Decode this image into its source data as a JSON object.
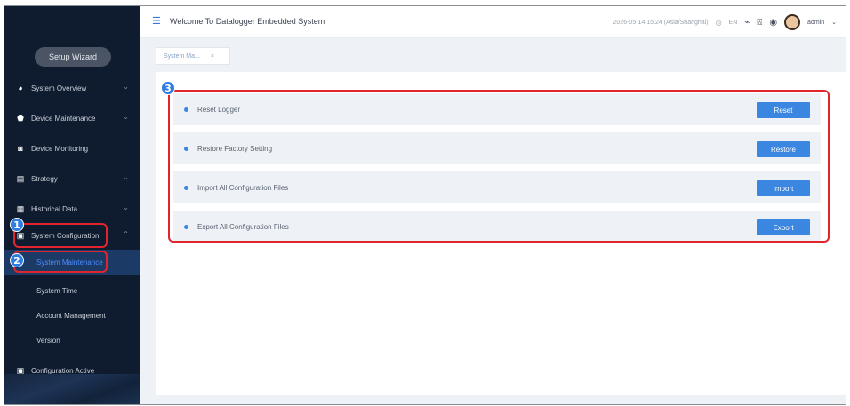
{
  "sidebar": {
    "wizard_label": "Setup Wizard",
    "items": [
      {
        "label": "System Overview",
        "icon": "gauge-icon",
        "has_chevron": true
      },
      {
        "label": "Device Maintenance",
        "icon": "shield-icon",
        "has_chevron": true
      },
      {
        "label": "Device Monitoring",
        "icon": "monitor-icon",
        "has_chevron": false
      },
      {
        "label": "Strategy",
        "icon": "strategy-icon",
        "has_chevron": true
      },
      {
        "label": "Historical Data",
        "icon": "history-icon",
        "has_chevron": true
      },
      {
        "label": "System Configuration",
        "icon": "config-icon",
        "has_chevron": true
      }
    ],
    "subitems": [
      {
        "label": "System Maintenance",
        "active": true
      },
      {
        "label": "System Time",
        "active": false
      },
      {
        "label": "Account Management",
        "active": false
      },
      {
        "label": "Version",
        "active": false
      }
    ],
    "config_active_label": "Configuration Active"
  },
  "header": {
    "title": "Welcome To Datalogger Embedded System",
    "datetime": "2026-05-14 15:24 (Asia/Shanghai)",
    "lang": "EN",
    "user": "admin"
  },
  "tab": {
    "label": "System Ma...",
    "close": "×"
  },
  "rows": [
    {
      "label": "Reset Logger",
      "button": "Reset"
    },
    {
      "label": "Restore Factory Setting",
      "button": "Restore"
    },
    {
      "label": "Import All Configuration Files",
      "button": "Import"
    },
    {
      "label": "Export All Configuration Files",
      "button": "Export"
    }
  ],
  "badges": {
    "one": "1",
    "two": "2",
    "three": "3"
  },
  "colors": {
    "accent": "#3a86e0",
    "sidebar": "#0f1b2e",
    "callout": "#e0252d"
  }
}
